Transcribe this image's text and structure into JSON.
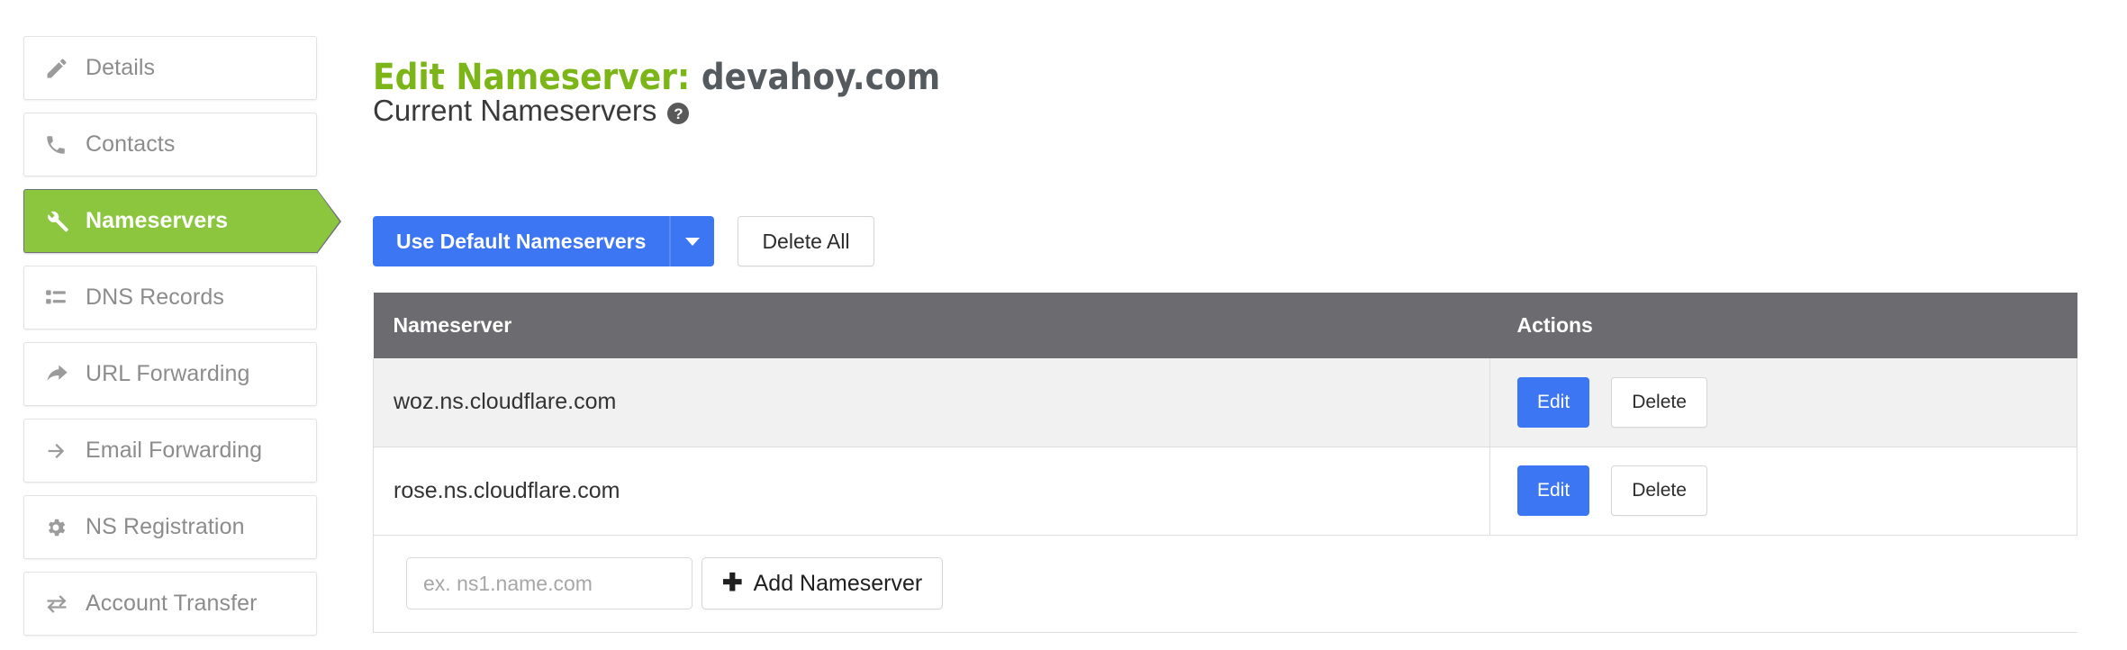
{
  "sidebar": {
    "items": [
      {
        "label": "Details",
        "icon": "pencil-icon",
        "active": false
      },
      {
        "label": "Contacts",
        "icon": "phone-icon",
        "active": false
      },
      {
        "label": "Nameservers",
        "icon": "wrench-icon",
        "active": true
      },
      {
        "label": "DNS Records",
        "icon": "list-icon",
        "active": false
      },
      {
        "label": "URL Forwarding",
        "icon": "share-arrow-icon",
        "active": false
      },
      {
        "label": "Email Forwarding",
        "icon": "arrow-right-icon",
        "active": false
      },
      {
        "label": "NS Registration",
        "icon": "gear-icon",
        "active": false
      },
      {
        "label": "Account Transfer",
        "icon": "exchange-arrows-icon",
        "active": false
      }
    ]
  },
  "header": {
    "title_prefix": "Edit Nameserver:",
    "title_domain": "devahoy.com"
  },
  "section": {
    "heading": "Current Nameservers",
    "help_icon_glyph": "?"
  },
  "toolbar": {
    "use_default_label": "Use Default Nameservers",
    "dropdown_icon": "chevron-down-icon",
    "delete_all_label": "Delete All"
  },
  "table": {
    "columns": [
      "Nameserver",
      "Actions"
    ],
    "rows": [
      {
        "nameserver": "woz.ns.cloudflare.com",
        "edit_label": "Edit",
        "delete_label": "Delete"
      },
      {
        "nameserver": "rose.ns.cloudflare.com",
        "edit_label": "Edit",
        "delete_label": "Delete"
      }
    ],
    "add_row": {
      "input_value": "",
      "input_placeholder": "ex. ns1.name.com",
      "add_button_label": "Add Nameserver",
      "add_button_icon": "plus-icon"
    }
  },
  "colors": {
    "accent_green": "#8cc63f",
    "title_green": "#7cb518",
    "primary_blue": "#3d76f2",
    "table_header_gray": "#6c6c70",
    "row_alt_gray": "#f1f1f1"
  }
}
